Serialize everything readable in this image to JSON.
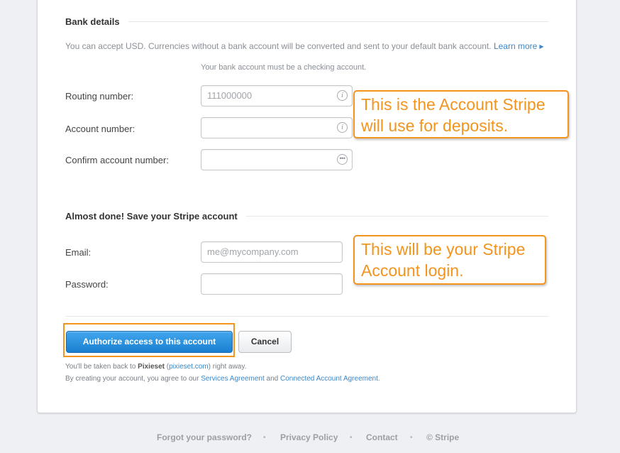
{
  "bank_details": {
    "title": "Bank details",
    "info_text": "You can accept USD. Currencies without a bank account will be converted and sent to your default bank account.",
    "learn_more": "Learn more",
    "checking_hint": "Your bank account must be a checking account.",
    "routing_label": "Routing number:",
    "routing_placeholder": "111000000",
    "account_label": "Account number:",
    "account_value": "",
    "confirm_label": "Confirm account number:",
    "confirm_value": ""
  },
  "save_account": {
    "title": "Almost done! Save your Stripe account",
    "email_label": "Email:",
    "email_placeholder": "me@mycompany.com",
    "password_label": "Password:",
    "password_value": ""
  },
  "annotations": {
    "callout_account": [
      "This is the Account Stripe",
      "will use for deposits."
    ],
    "callout_login": [
      "This will be your Stripe",
      "Account login."
    ],
    "accent_color": "#f2941e"
  },
  "actions": {
    "authorize_label": "Authorize access to this account",
    "cancel_label": "Cancel"
  },
  "legal": {
    "redirect_prefix": "You'll be taken back to",
    "app_name": "Pixieset",
    "app_url": "pixieset.com",
    "redirect_suffix": "right away.",
    "agreement_prefix": "By creating your account, you agree to our",
    "services_link": "Services Agreement",
    "and": "and",
    "connected_link": "Connected Account Agreement"
  },
  "footer": {
    "forgot_password": "Forgot your password?",
    "privacy": "Privacy Policy",
    "contact": "Contact",
    "copyright": "© Stripe",
    "separator": "•"
  },
  "colors": {
    "link": "#3b87c7",
    "primary_button": "#1a7fd1"
  },
  "icons": {
    "routing": "info-icon",
    "account": "info-icon",
    "confirm": "ellipsis-icon",
    "learn_more": "caret-right-icon"
  }
}
